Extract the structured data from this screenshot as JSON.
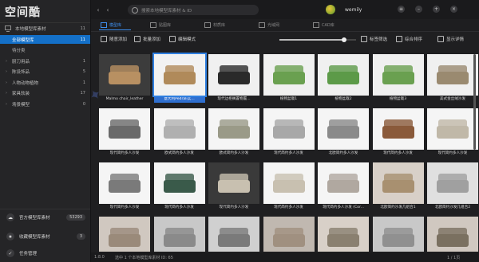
{
  "app": {
    "title": "空间酷"
  },
  "sidebar": {
    "local_library": {
      "label": "本地模型库素材",
      "count": "11"
    },
    "items": [
      {
        "label": "全部模型库",
        "count": "11",
        "selected": true,
        "caret": ""
      },
      {
        "label": "待分类",
        "count": "",
        "caret": ""
      },
      {
        "label": "厨刀用品",
        "count": "1",
        "caret": "›"
      },
      {
        "label": "陈设饰品",
        "count": "5",
        "caret": "›"
      },
      {
        "label": "人物动物植物",
        "count": "1",
        "caret": "›"
      },
      {
        "label": "家具软装",
        "count": "17",
        "caret": "›"
      },
      {
        "label": "场景模型",
        "count": "0",
        "caret": "›"
      }
    ],
    "bottom": [
      {
        "label": "官方模型库素材",
        "count": "53293",
        "icon": "cloud-icon"
      },
      {
        "label": "收藏模型库素材",
        "count": "3",
        "icon": "star-icon"
      },
      {
        "label": "任务管理",
        "count": "",
        "icon": "task-icon"
      }
    ]
  },
  "topbar": {
    "search_placeholder": "搜索本地模型库素材 & ID",
    "username": "wemily"
  },
  "tabs": [
    {
      "label": "模型库",
      "active": true
    },
    {
      "label": "贴图库",
      "active": false
    },
    {
      "label": "材质库",
      "active": false
    },
    {
      "label": "光域网",
      "active": false
    },
    {
      "label": "CAD库",
      "active": false
    }
  ],
  "toolbar": {
    "quick_add": "随意添加",
    "batch_add": "批量添加",
    "edit_mode": "编辑模式",
    "tag_filter": "标签筛选",
    "sort": "综合排序",
    "show_details": "显示详情"
  },
  "grid": [
    {
      "caption": "Malmo chair_leather",
      "color": "#b89062",
      "bg": "#3c3c3c",
      "selected": false
    },
    {
      "caption": "意大利Pedrali实...",
      "color": "#b08a5a",
      "bg": "#f2f2f2",
      "selected": true
    },
    {
      "caption": "现代边柜搁置物置...",
      "color": "#2a2a2a",
      "bg": "#f0f0f0",
      "selected": false
    },
    {
      "caption": "植物盆栽1",
      "color": "#6aa050",
      "bg": "#f0f0f0",
      "selected": false
    },
    {
      "caption": "植物盆栽2",
      "color": "#5c9a48",
      "bg": "#f0f0f0",
      "selected": false
    },
    {
      "caption": "植物盆栽3",
      "color": "#6aa050",
      "bg": "#f0f0f0",
      "selected": false
    },
    {
      "caption": "美式金丝绒沙发",
      "color": "#9a8a70",
      "bg": "#f0f0f0",
      "selected": false
    },
    {
      "caption": "现代简约多人沙发",
      "color": "#6a6a6a",
      "bg": "#f5f5f5",
      "selected": false
    },
    {
      "caption": "欧式简约多人沙发",
      "color": "#b0b0b0",
      "bg": "#f5f5f5",
      "selected": false
    },
    {
      "caption": "欧式简约多人沙发",
      "color": "#9a9a88",
      "bg": "#f5f5f5",
      "selected": false
    },
    {
      "caption": "现代简约多人沙发",
      "color": "#a8a8a8",
      "bg": "#f5f5f5",
      "selected": false
    },
    {
      "caption": "北欧简约多人沙发",
      "color": "#8a8a8a",
      "bg": "#f5f5f5",
      "selected": false
    },
    {
      "caption": "现代简约多人沙发",
      "color": "#8a5a3a",
      "bg": "#f5f5f5",
      "selected": false
    },
    {
      "caption": "现代简约多人沙发",
      "color": "#c0b8a8",
      "bg": "#f5f5f5",
      "selected": false
    },
    {
      "caption": "现代简约多人沙发",
      "color": "#7a7a7a",
      "bg": "#f5f5f5",
      "selected": false
    },
    {
      "caption": "现代简约多人沙发",
      "color": "#3a5a4a",
      "bg": "#f5f5f5",
      "selected": false
    },
    {
      "caption": "现代简约多人沙发",
      "color": "#c8c0b0",
      "bg": "#3a3a3a",
      "selected": false
    },
    {
      "caption": "现代简约多人沙发",
      "color": "#c8c0b0",
      "bg": "#f5f5f5",
      "selected": false
    },
    {
      "caption": "现代简约多人沙发 (Cor...",
      "color": "#b0a8a0",
      "bg": "#f5f5f5",
      "selected": false
    },
    {
      "caption": "北欧简约沙发几组合1",
      "color": "#a89070",
      "bg": "#d8d0c8",
      "selected": false
    },
    {
      "caption": "北欧简约沙发几组合2",
      "color": "#a0a0a0",
      "bg": "#e0e0e0",
      "selected": false
    },
    {
      "caption": "",
      "color": "#9a8a7a",
      "bg": "#d0c8c0",
      "selected": false
    },
    {
      "caption": "",
      "color": "#8a8a8a",
      "bg": "#c8c8c8",
      "selected": false
    },
    {
      "caption": "",
      "color": "#7a7a7a",
      "bg": "#d0d0d0",
      "selected": false
    },
    {
      "caption": "",
      "color": "#a09080",
      "bg": "#c0b8b0",
      "selected": false
    },
    {
      "caption": "",
      "color": "#8a8070",
      "bg": "#d8d0c8",
      "selected": false
    },
    {
      "caption": "",
      "color": "#909090",
      "bg": "#c8c8c8",
      "selected": false
    },
    {
      "caption": "",
      "color": "#7a7060",
      "bg": "#d0c8c0",
      "selected": false
    }
  ],
  "status": {
    "text": "选中 1 个本地模型库素材 ID: 65",
    "left": "1:8.0",
    "page": "1 / 1页"
  }
}
